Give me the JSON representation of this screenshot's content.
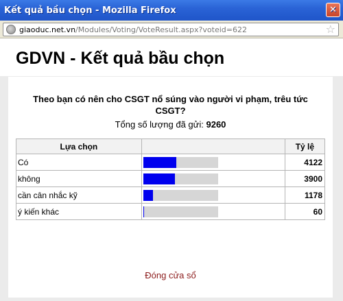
{
  "window": {
    "title": "Kết quả bầu chọn - Mozilla Firefox",
    "close_symbol": "✕"
  },
  "address_bar": {
    "host": "giaoduc.net.vn",
    "path": "/Modules/Voting/VoteResult.aspx?voteid=622",
    "star_symbol": "☆",
    "icons": [
      "globe-icon",
      "star-icon"
    ]
  },
  "page": {
    "heading": "GDVN - Kết quả bầu chọn",
    "question": "Theo bạn có nên cho CSGT nổ súng vào người vi phạm, trêu tức CSGT?",
    "total_label": "Tổng số lượng đã gửi:",
    "total_value": "9260",
    "columns": {
      "option": "Lựa chọn",
      "bar": "",
      "ratio": "Tỷ lệ"
    },
    "results": [
      {
        "label": "Có",
        "count": "4122",
        "fraction": 0.445
      },
      {
        "label": "không",
        "count": "3900",
        "fraction": 0.421
      },
      {
        "label": "cần cân nhắc kỹ",
        "count": "1178",
        "fraction": 0.127
      },
      {
        "label": "ý kiến khác",
        "count": "60",
        "fraction": 0.006
      }
    ],
    "close_label": "Đóng cửa sổ",
    "bar_color": "#0000ee",
    "track_color": "#d6d6d6"
  }
}
